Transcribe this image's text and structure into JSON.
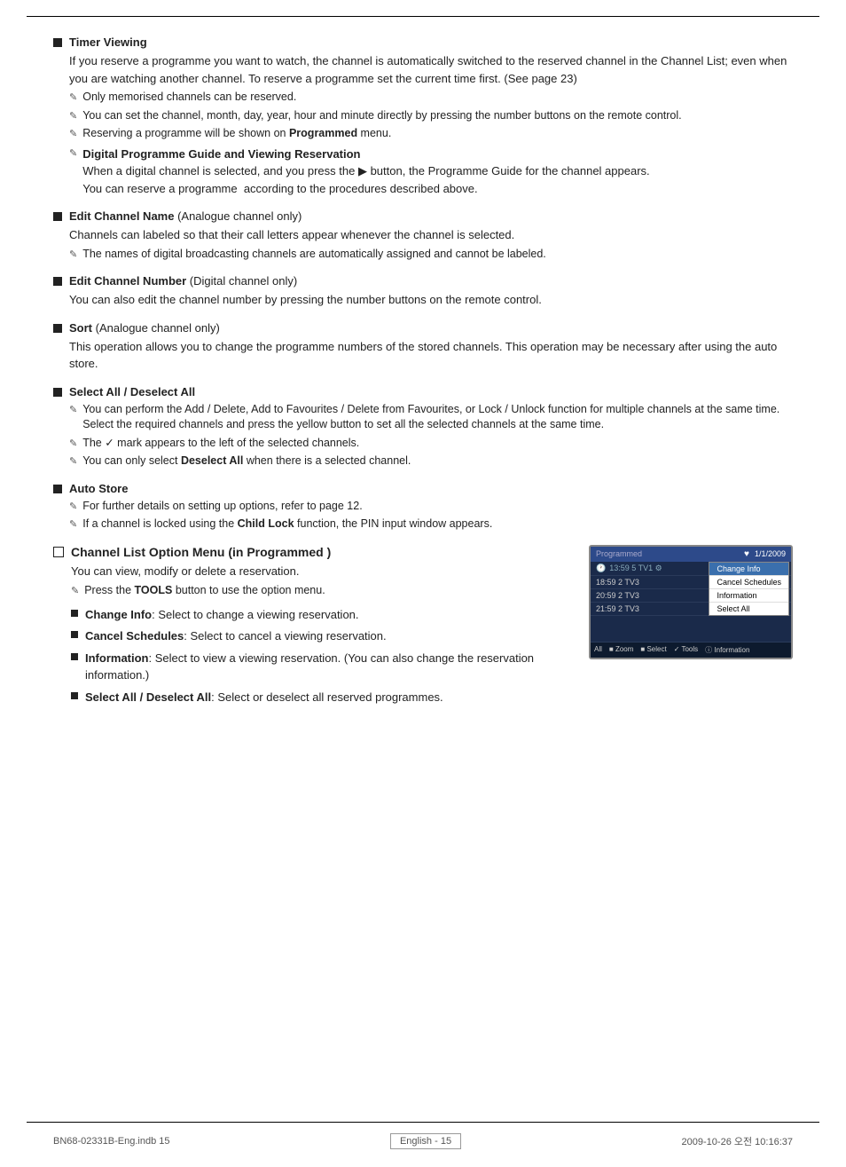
{
  "page": {
    "footer_left": "BN68-02331B-Eng.indb   15",
    "footer_page": "English - 15",
    "footer_right": "2009-10-26   오전  10:16:37"
  },
  "sections": [
    {
      "id": "timer-viewing",
      "title": "Timer Viewing",
      "body": "If you reserve a programme you want to watch, the channel is automatically switched to the reserved channel in the Channel List; even when you are watching another channel. To reserve a programme set the current time first. (See page 23)",
      "notes": [
        "Only memorised channels can be reserved.",
        "You can set the channel, month, day, year, hour and minute directly by pressing the number buttons on the remote control.",
        "Reserving a programme will be shown on Programmed menu."
      ],
      "sub_section": {
        "title": "Digital Programme Guide and Viewing Reservation",
        "body": "When a digital channel is selected, and you press the ▶ button, the Programme Guide for the channel appears.\nYou can reserve a programme  according to the procedures described above."
      }
    },
    {
      "id": "edit-channel-name",
      "title": "Edit Channel Name",
      "title_suffix": " (Analogue channel only)",
      "body": "Channels can labeled so that their call letters appear whenever the channel is selected.",
      "notes": [
        "The names of digital broadcasting channels are automatically assigned and cannot be labeled."
      ]
    },
    {
      "id": "edit-channel-number",
      "title": "Edit Channel Number",
      "title_suffix": " (Digital channel only)",
      "body": "You can also edit the channel number by pressing the number buttons on the remote control.",
      "notes": []
    },
    {
      "id": "sort",
      "title": "Sort",
      "title_suffix": " (Analogue channel only)",
      "body": "This operation allows you to change the programme numbers of the stored channels. This operation may be necessary after using the auto store.",
      "notes": []
    },
    {
      "id": "select-all",
      "title": "Select All / Deselect All",
      "body": "",
      "notes": [
        "You can perform the Add / Delete, Add to Favourites / Delete from Favourites, or Lock / Unlock function for multiple channels at the same time. Select the required channels and press the yellow button to set all the selected channels at the same time.",
        "The ✓ mark appears to the left of the selected channels.",
        "You can only select Deselect All when there is a selected channel."
      ]
    },
    {
      "id": "auto-store",
      "title": "Auto Store",
      "body": "",
      "notes": [
        "For further details on setting up options, refer to page 12.",
        "If a channel is locked using the Child Lock function, the PIN input window appears."
      ]
    }
  ],
  "channel_list_section": {
    "header": "Channel List Option Menu ",
    "header_bold": "in Programmed )",
    "header_prefix": "(",
    "body": "You can view, modify or delete a reservation.",
    "note": "Press the TOOLS button to use the option menu.",
    "items": [
      {
        "label": "Change Info",
        "desc": "Select to change a viewing reservation."
      },
      {
        "label": "Cancel Schedules",
        "desc": "Select to cancel a viewing reservation."
      },
      {
        "label": "Information",
        "desc": "Select to view a viewing reservation. (You can also change the reservation information.)"
      },
      {
        "label": "Select All / Deselect All",
        "desc": "Select or deselect all reserved programmes."
      }
    ]
  },
  "tv_screen": {
    "label": "Programmed",
    "date": "1/1/2009",
    "rows": [
      {
        "time": "13:59",
        "num": "5",
        "ch": "TV1",
        "selected": true
      },
      {
        "time": "18:59",
        "num": "2",
        "ch": "TV3",
        "selected": false
      },
      {
        "time": "20:59",
        "num": "2",
        "ch": "TV3",
        "selected": false
      },
      {
        "time": "21:59",
        "num": "2",
        "ch": "TV3",
        "selected": false
      }
    ],
    "context_menu": [
      {
        "label": "Change Info",
        "highlighted": true
      },
      {
        "label": "Cancel Schedules",
        "highlighted": false
      },
      {
        "label": "Information",
        "highlighted": false
      },
      {
        "label": "Select All",
        "highlighted": false
      }
    ],
    "bottom_bar": "All   ■ Zoom  ■ Select  ✓ Tools  ⓘ Information"
  }
}
